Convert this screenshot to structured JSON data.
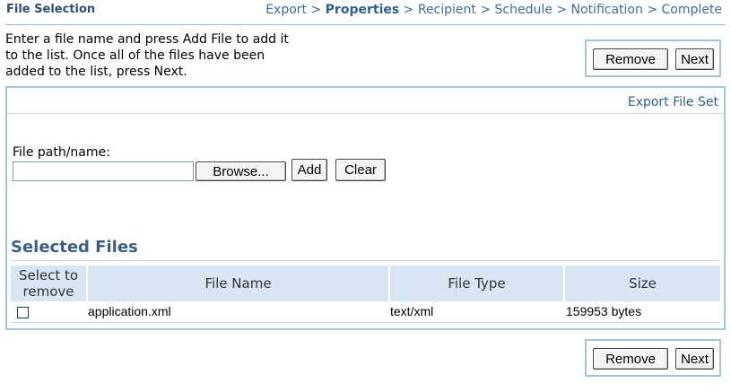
{
  "header": {
    "title": "File Selection",
    "breadcrumb": [
      {
        "label": "Export",
        "current": false
      },
      {
        "label": "Properties",
        "current": true
      },
      {
        "label": "Recipient",
        "current": false
      },
      {
        "label": "Schedule",
        "current": false
      },
      {
        "label": "Notification",
        "current": false
      },
      {
        "label": "Complete",
        "current": false
      }
    ],
    "separator": ">"
  },
  "instructions": "Enter a file name and press Add File to add it to the list. Once all of the files have been added to the list, press Next.",
  "top_actions": {
    "remove_label": "Remove",
    "next_label": "Next"
  },
  "panel": {
    "header_link": "Export File Set",
    "file_field": {
      "label": "File path/name:",
      "value": "",
      "placeholder": ""
    },
    "browse_label": "Browse...",
    "add_label": "Add",
    "clear_label": "Clear"
  },
  "selected_files": {
    "title": "Selected Files",
    "columns": [
      "Select to remove",
      "File Name",
      "File Type",
      "Size"
    ],
    "rows": [
      {
        "checked": false,
        "name": "application.xml",
        "type": "text/xml",
        "size": "159953 bytes"
      }
    ]
  },
  "bottom_actions": {
    "remove_label": "Remove",
    "next_label": "Next"
  },
  "colors": {
    "accent": "#3c6e9e",
    "table_header_bg": "#d7e6f2",
    "border": "#a8c4dc"
  }
}
